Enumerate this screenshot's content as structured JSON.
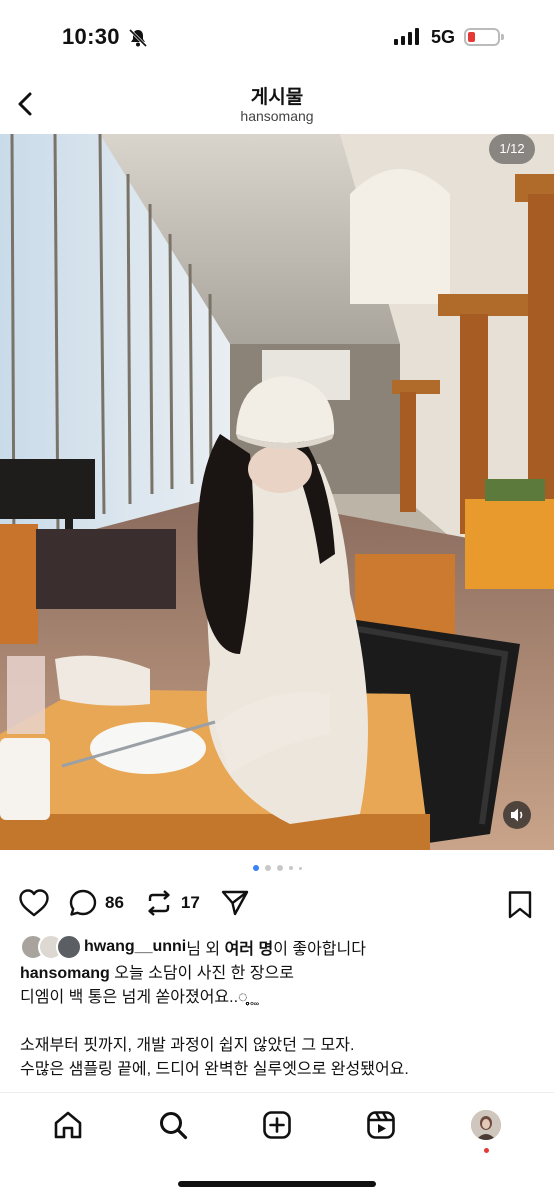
{
  "status": {
    "time": "10:30",
    "network": "5G",
    "battery_color": "#e53935"
  },
  "header": {
    "title": "게시물",
    "username": "hansomang"
  },
  "post": {
    "image_counter": "1/12",
    "carousel": {
      "active_index": 0,
      "dots_visible": 5
    },
    "comments_count": "86",
    "reposts_count": "17",
    "likes": {
      "user": "hwang__unni",
      "suffix_1": "님 외 ",
      "bold": "여러 명",
      "suffix_2": "이 좋아합니다"
    },
    "caption": {
      "author": "hansomang",
      "line1": " 오늘 소담이 사진 한 장으로",
      "line2": "디엠이 백 통은 넘게 쏟아졌어요..◌̥̥̥̥̥̥̥̥̥̥̥̥̥̥̥̥ ̥ ͚",
      "line3": "소재부터 핏까지, 개발 과정이 쉽지 않았던 그 모자.",
      "line4": "수많은 샘플링 끝에, 드디어 완벽한 실루엣으로 완성됐어요."
    }
  },
  "nav": {
    "items": [
      "home-icon",
      "search-icon",
      "create-icon",
      "reels-icon",
      "profile-avatar"
    ]
  },
  "colors": {
    "accent_dot": "#3b82f6",
    "notification": "#e53935"
  }
}
